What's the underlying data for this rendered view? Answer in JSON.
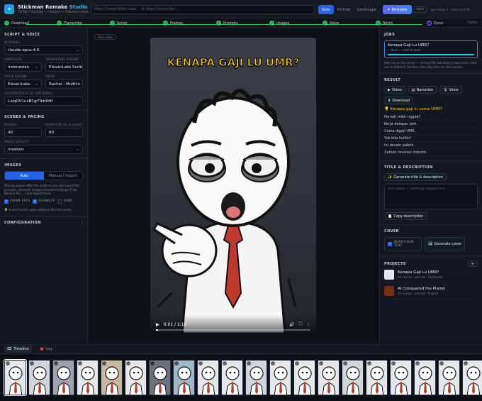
{
  "header": {
    "title_main": "Stickman Remake",
    "title_accent": "Studio",
    "subtitle": "TikTok / YouTube → relaxed + stickman video",
    "url_placeholder": "https://www.tiktok.com/...  or  https://youtu.be/...",
    "modes": [
      "Auto",
      "Portrait",
      "Landscape"
    ],
    "active_mode": "Auto",
    "remake_label": "Remake",
    "status_pill": "done",
    "meta": "gpt-image-1 · mmx-v2.5-tts"
  },
  "steps": [
    {
      "label": "Download",
      "state": "done"
    },
    {
      "label": "Transcribe",
      "state": "done"
    },
    {
      "label": "Script",
      "state": "done"
    },
    {
      "label": "Frames",
      "state": "done"
    },
    {
      "label": "Prompts",
      "state": "done"
    },
    {
      "label": "Images",
      "state": "done"
    },
    {
      "label": "Voice",
      "state": "done"
    },
    {
      "label": "Stitch",
      "state": "done"
    },
    {
      "label": "Done",
      "state": "current",
      "number": "9"
    }
  ],
  "steps_meta": "stylido",
  "left": {
    "script_voice_title": "SCRIPT & VOICE",
    "ai_model_label": "AI MODEL",
    "ai_model": "claude-opus-4-6",
    "language_label": "LANGUAGE",
    "language": "Indonesian",
    "transcribe_label": "TRANSCRIBE ENGINE",
    "transcribe": "ElevenLabs Scrib",
    "voice_engine_label": "VOICE ENGINE",
    "voice_engine": "ElevenLabs",
    "voice_label": "VOICE",
    "voice": "Rachel - Multilin",
    "custom_voice_label": "CUSTOM VOICE ID (OPTIONAL)",
    "custom_voice": "LxlqOV1uxBCgYTeltAHf",
    "scenes_title": "SCENES & PACING",
    "scenes_label": "SCENES",
    "scenes": "40",
    "duration_label": "DURATION (S, 0=auto)",
    "duration": "60",
    "quality_label": "IMAGE QUALITY",
    "quality": "medium",
    "images_title": "IMAGES",
    "images_modes": [
      "Auto",
      "Manual / Import"
    ],
    "images_hint": "Manual pauses after the script so you can export the prompts, generate images elsewhere (Google Flow, Banana Pro, ...) and import them.",
    "checks": [
      {
        "label": "FRAME REFS",
        "checked": true
      },
      {
        "label": "SOUND FX",
        "checked": true
      },
      {
        "label": "SUBS",
        "checked": false
      }
    ],
    "hook_note": "A viral hook is auto-added as the first scene.",
    "config_title": "CONFIGURATION"
  },
  "center": {
    "final_tag": "final video",
    "caption": "KENAPA GAJI LU UMR?",
    "time": "0:01 / 1:10",
    "progress": 0.015
  },
  "right": {
    "jobs_title": "JOBS",
    "job_title": "Kenapa Gaji Lu UMR?",
    "job_sub": "✓ done — click to open",
    "jobs_note": "Jobs run on the server — closing this tab doesn't stop them. Click one to follow it; finished ones stay here for this session.",
    "result_title": "RESULT",
    "result_buttons": [
      "Video",
      "Narration",
      "Voice"
    ],
    "download_label": "Download",
    "hooks_title": "Kenapa gaji lu cuma UMR?",
    "hooks": [
      "Pernah mikir nggak?",
      "Kerja delapan jam.",
      "Cuma digaji UMR.",
      "Yuk kita kulitin!",
      "Ini desain pabrik.",
      "Zaman revolusi industri"
    ],
    "title_desc_title": "TITLE & DESCRIPTION",
    "generate_td_label": "Generate title & description",
    "desc_placeholder": "description + hashtags appear here...",
    "copy_desc_label": "Copy description",
    "cover_title": "COVER",
    "burn_hook_label": "BURN HOOK TEXT",
    "generate_cover_label": "Generate cover",
    "projects_title": "PROJECTS",
    "projects": [
      {
        "title": "Kenapa Gaji Lu UMR?",
        "sub": "40 scenes · portrait · Indonesian"
      },
      {
        "title": "AI Conquered the Planet",
        "sub": "35 scenes · portrait · English"
      }
    ]
  },
  "bottom": {
    "tabs": [
      "Timeline",
      "Log"
    ],
    "active_tab": "Timeline"
  },
  "colors": {
    "accent": "#2563eb",
    "success": "#22c55e",
    "caption": "#facc15"
  }
}
